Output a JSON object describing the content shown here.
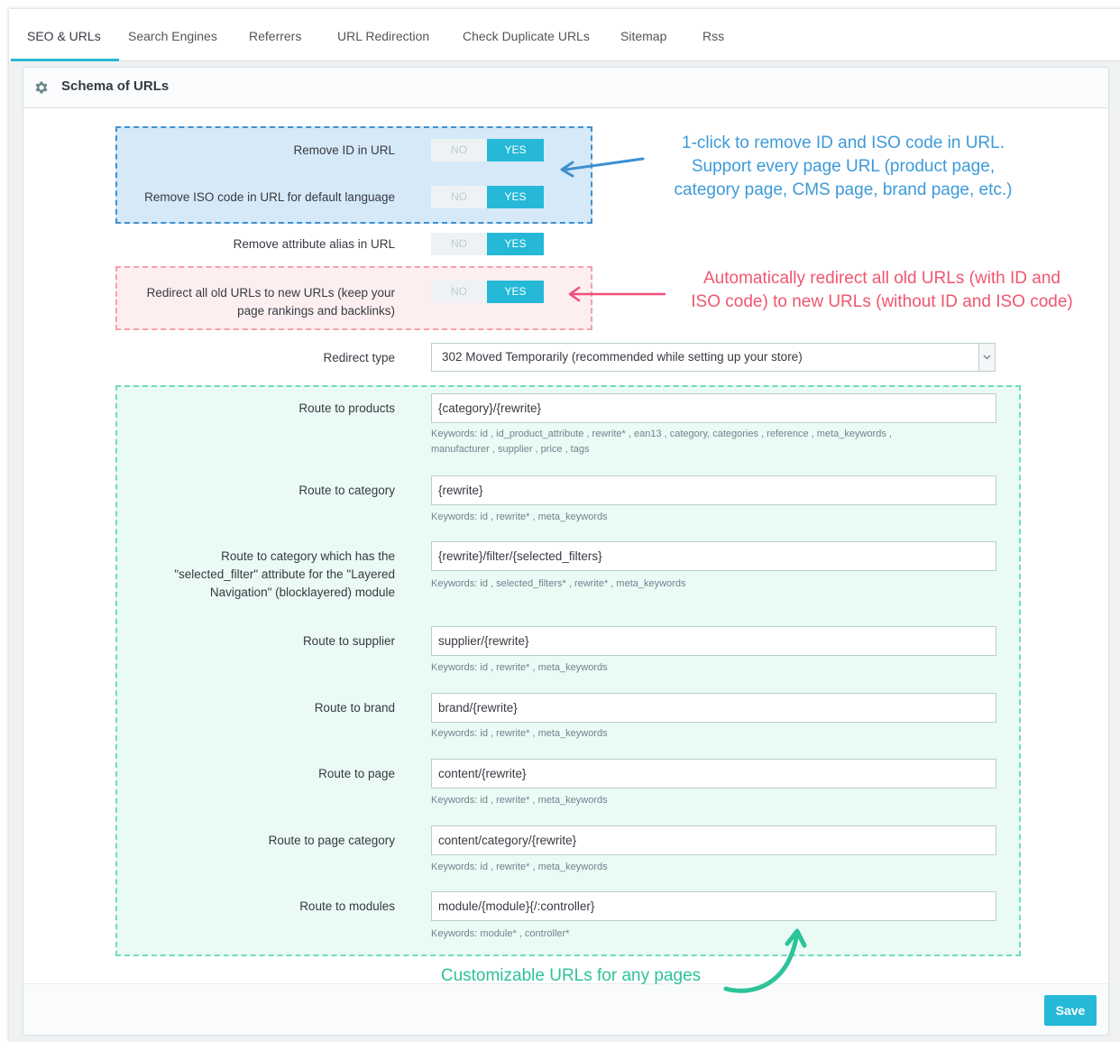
{
  "tabs": [
    {
      "label": "SEO & URLs",
      "active": true
    },
    {
      "label": "Search Engines"
    },
    {
      "label": "Referrers"
    },
    {
      "label": "URL Redirection"
    },
    {
      "label": "Check Duplicate URLs"
    },
    {
      "label": "Sitemap"
    },
    {
      "label": "Rss"
    }
  ],
  "panel": {
    "title": "Schema of URLs",
    "icon": "gear-icon"
  },
  "switches": {
    "remove_id": {
      "label": "Remove ID in URL",
      "no": "NO",
      "yes": "YES",
      "value": "YES"
    },
    "remove_iso": {
      "label": "Remove ISO code in URL for default language",
      "no": "NO",
      "yes": "YES",
      "value": "YES"
    },
    "remove_attr": {
      "label": "Remove attribute alias in URL",
      "no": "NO",
      "yes": "YES",
      "value": "YES"
    },
    "redirect_old": {
      "label_line1": "Redirect all old URLs to new URLs (keep your",
      "label_line2": "page rankings and backlinks)",
      "no": "NO",
      "yes": "YES",
      "value": "YES"
    }
  },
  "redirect_type": {
    "label": "Redirect type",
    "value": "302 Moved Temporarily (recommended while setting up your store)"
  },
  "routes": {
    "products": {
      "label": "Route to products",
      "value": "{category}/{rewrite}",
      "keywords_line1": "Keywords: id , id_product_attribute , rewrite* , ean13 , category, categories , reference , meta_keywords ,",
      "keywords_line2": "manufacturer , supplier , price , tags"
    },
    "category": {
      "label": "Route to category",
      "value": "{rewrite}",
      "keywords": "Keywords: id , rewrite* , meta_keywords"
    },
    "layered": {
      "label_line1": "Route to category which has the",
      "label_line2": "\"selected_filter\" attribute for the \"Layered",
      "label_line3": "Navigation\" (blocklayered) module",
      "value": "{rewrite}/filter/{selected_filters}",
      "keywords": "Keywords: id , selected_filters* , rewrite* , meta_keywords"
    },
    "supplier": {
      "label": "Route to supplier",
      "value": "supplier/{rewrite}",
      "keywords": "Keywords: id , rewrite* , meta_keywords"
    },
    "brand": {
      "label": "Route to brand",
      "value": "brand/{rewrite}",
      "keywords": "Keywords: id , rewrite* , meta_keywords"
    },
    "page": {
      "label": "Route to page",
      "value": "content/{rewrite}",
      "keywords": "Keywords: id , rewrite* , meta_keywords"
    },
    "page_category": {
      "label": "Route to page category",
      "value": "content/category/{rewrite}",
      "keywords": "Keywords: id , rewrite* , meta_keywords"
    },
    "modules": {
      "label": "Route to modules",
      "value": "module/{module}{/:controller}",
      "keywords": "Keywords: module* , controller*"
    }
  },
  "annotations": {
    "blue": {
      "line1": "1-click to remove ID and ISO code in URL.",
      "line2": "Support every page URL (product page,",
      "line3": "category page, CMS page, brand page, etc.)",
      "color": "#3d9ad9"
    },
    "pink": {
      "line1": "Automatically redirect all old URLs (with ID and",
      "line2": "ISO code) to new URLs (without ID and ISO code)",
      "color": "#f0566e"
    },
    "green": {
      "text": "Customizable URLs for any pages",
      "color": "#2dc399"
    }
  },
  "footer": {
    "save_label": "Save"
  },
  "colors": {
    "accent": "#25b9d7"
  }
}
